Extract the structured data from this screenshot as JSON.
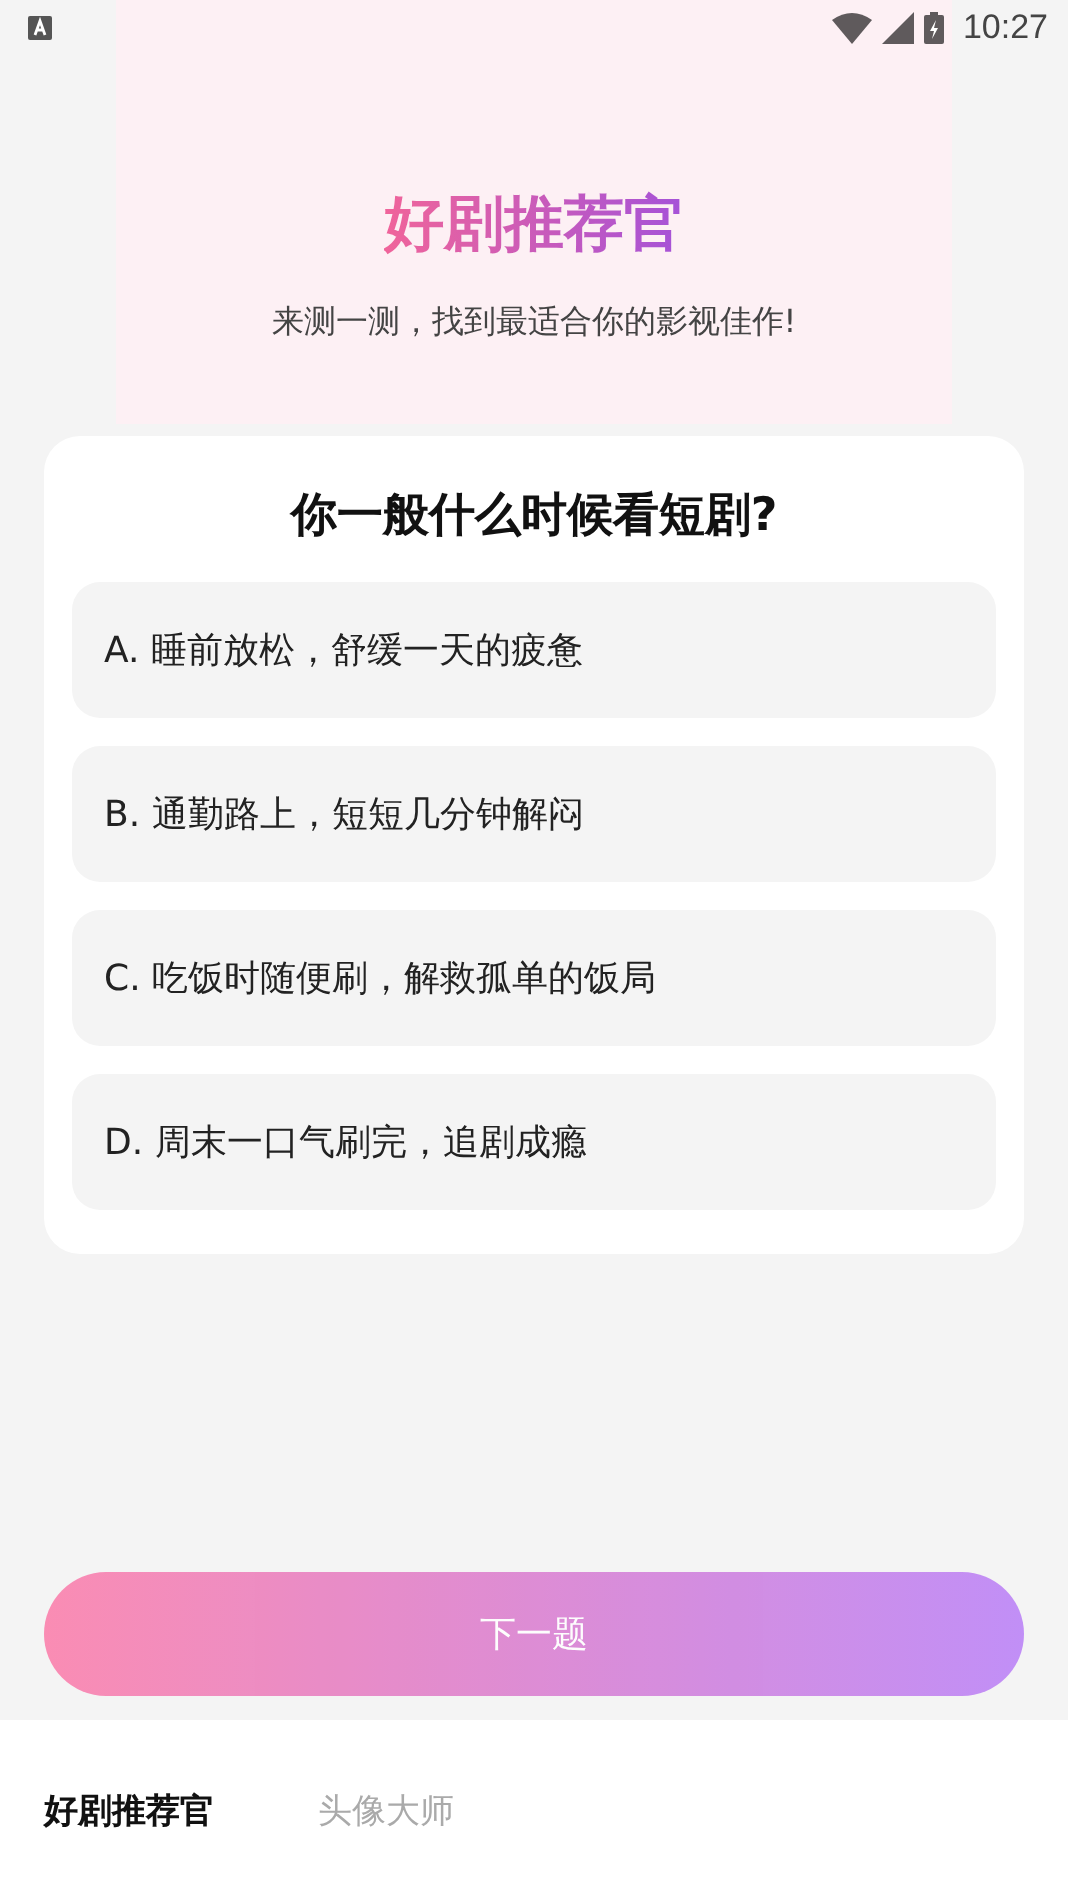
{
  "status_bar": {
    "time": "10:27"
  },
  "header": {
    "title": "好剧推荐官",
    "subtitle": "来测一测，找到最适合你的影视佳作!"
  },
  "question": {
    "text": "你一般什么时候看短剧?",
    "options": [
      {
        "label": "A. 睡前放松，舒缓一天的疲惫",
        "selected": false
      },
      {
        "label": "B. 通勤路上，短短几分钟解闷",
        "selected": false
      },
      {
        "label": "C. 吃饭时随便刷，解救孤单的饭局",
        "selected": false
      },
      {
        "label": "D. 周末一口气刷完，追剧成瘾",
        "selected": false
      }
    ]
  },
  "next_button": {
    "label": "下一题",
    "disabled": true
  },
  "tabs": [
    {
      "label": "好剧推荐官",
      "selected": true
    },
    {
      "label": "头像大师",
      "selected": false
    }
  ]
}
